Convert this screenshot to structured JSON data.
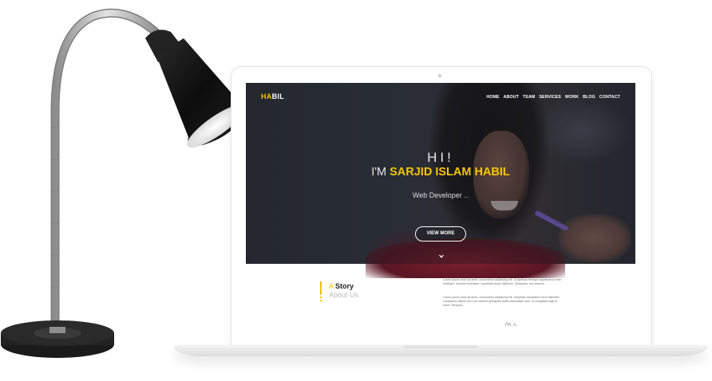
{
  "site": {
    "logo": {
      "part1": "HA",
      "part2": "BIL"
    },
    "nav": [
      "HOME",
      "ABOUT",
      "TEAM",
      "SERVICES",
      "WORK",
      "BLOG",
      "CONTACT"
    ]
  },
  "hero": {
    "greeting": "HI!",
    "name_prefix": "I'M ",
    "name_highlight": "SARJID ISLAM HABIL",
    "role": "Web Developer",
    "role_cursor": "...",
    "cta": "VIEW MORE",
    "scroll_icon": "chevron-down-icon"
  },
  "story": {
    "title_a": "A ",
    "title_b": "Story",
    "subtitle": "About Us",
    "paragraph1": "Lorem ipsum dolor sit amet, consectetur adipiscing elit. Ut aperiam firmique dignissimos enim similique, dolorem molestiae, cupiditate atque distinctio. Quisquam, eos dolores.",
    "paragraph2": "Lorem ipsum dolor sit amet, consectetur adipiscing elit. Voluptate voluptatum error blanditiis voluptatum officiis vero non dolores quisquam facilis laboriosam quis, ut voluptates fugit et esse? Tempora."
  },
  "colors": {
    "accent": "#f3c400",
    "hero_dark": "#2d3139",
    "story_text": "#222222"
  }
}
